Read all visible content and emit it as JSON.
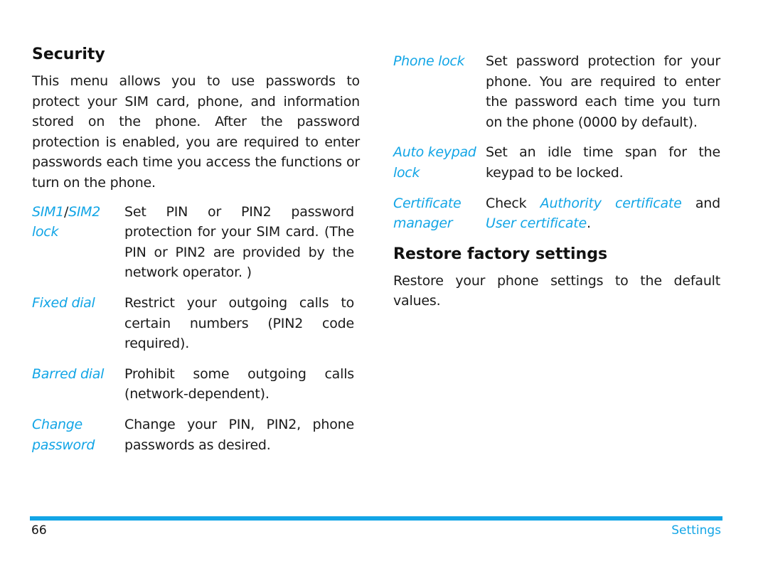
{
  "left": {
    "heading": "Security",
    "intro": "This menu allows you to use passwords to protect your SIM card, phone, and information stored on the phone. After the password protection is enabled, you are required to enter passwords each time you access the functions or turn on the phone.",
    "items": [
      {
        "term_a": "SIM1",
        "term_sep": "/",
        "term_b": "SIM2 lock",
        "desc": "Set PIN or PIN2 password protection for your SIM card. (The PIN or PIN2 are provided by the network operator. )"
      },
      {
        "term": "Fixed dial",
        "desc": "Restrict your outgoing calls to certain numbers (PIN2 code required)."
      },
      {
        "term": "Barred dial",
        "desc": "Prohibit some outgoing calls (network-dependent)."
      },
      {
        "term": "Change password",
        "desc": "Change your PIN, PIN2, phone passwords as desired."
      }
    ]
  },
  "right": {
    "items": [
      {
        "term": "Phone lock",
        "desc": "Set password protection for your phone. You are required to enter the password each time you turn on the phone (0000 by default)."
      },
      {
        "term": "Auto keypad lock",
        "desc": "Set an idle time span for the keypad to be locked."
      },
      {
        "term": "Certificate manager",
        "desc_prefix": "Check ",
        "link1": "Authority certificate",
        "desc_mid": " and ",
        "link2": "User certificate",
        "desc_suffix": "."
      }
    ],
    "heading": "Restore factory settings",
    "restore_text": "Restore your phone settings to the default values."
  },
  "footer": {
    "page_number": "66",
    "section": "Settings",
    "accent_color": "#12a5e6"
  }
}
